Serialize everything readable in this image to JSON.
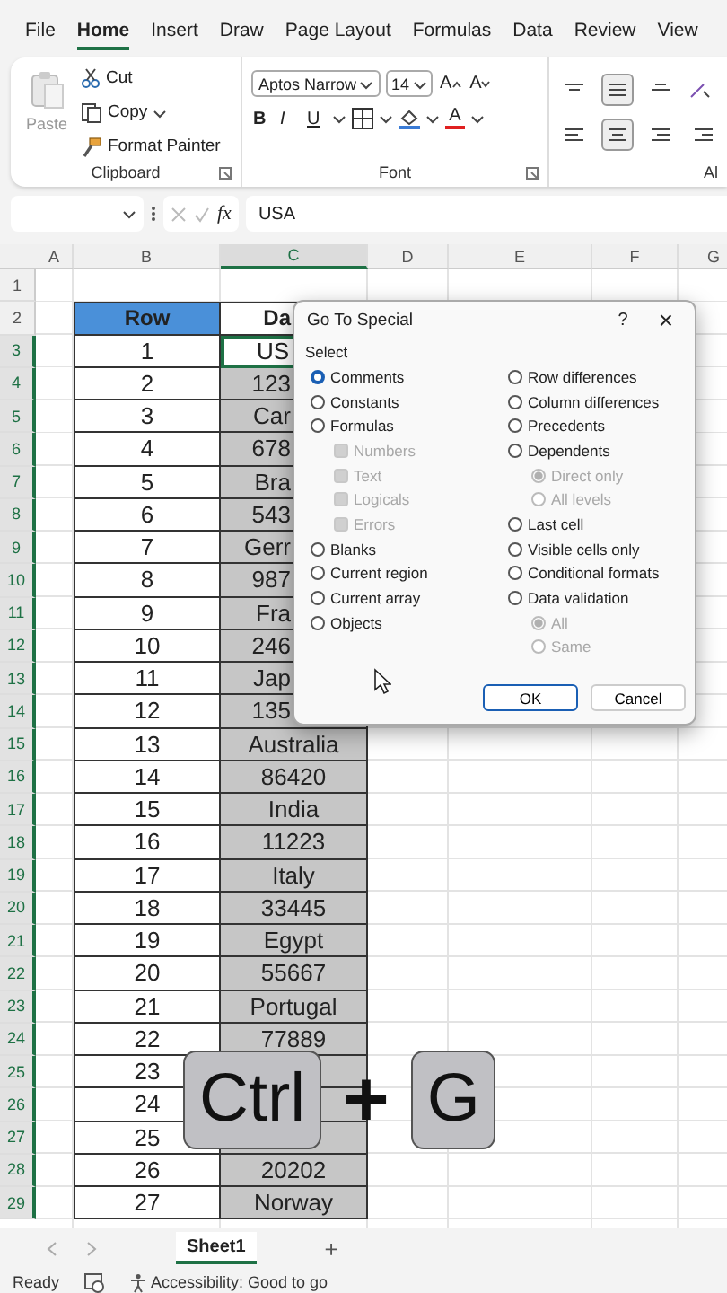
{
  "ribbon_tabs": [
    {
      "label": "File",
      "selected": false
    },
    {
      "label": "Home",
      "selected": true
    },
    {
      "label": "Insert",
      "selected": false
    },
    {
      "label": "Draw",
      "selected": false
    },
    {
      "label": "Page Layout",
      "selected": false
    },
    {
      "label": "Formulas",
      "selected": false
    },
    {
      "label": "Data",
      "selected": false
    },
    {
      "label": "Review",
      "selected": false
    },
    {
      "label": "View",
      "selected": false
    }
  ],
  "clipboard": {
    "paste": "Paste",
    "cut": "Cut",
    "copy": "Copy",
    "format_painter": "Format Painter",
    "label": "Clipboard"
  },
  "font": {
    "name": "Aptos Narrow",
    "size": "14",
    "grow": "A",
    "shrink": "A",
    "bold": "B",
    "italic": "I",
    "underline": "U",
    "font_color": "A",
    "label": "Font"
  },
  "alignment": {
    "label": "Al"
  },
  "formula_bar": {
    "fx": "fx",
    "value": "USA"
  },
  "columns": [
    {
      "label": "A",
      "selected": false
    },
    {
      "label": "B",
      "selected": false
    },
    {
      "label": "C",
      "selected": true
    },
    {
      "label": "D",
      "selected": false
    },
    {
      "label": "E",
      "selected": false
    },
    {
      "label": "F",
      "selected": false
    },
    {
      "label": "G",
      "selected": false
    }
  ],
  "rows": [
    {
      "n": "1",
      "kind": "blank"
    },
    {
      "n": "2",
      "kind": "header",
      "b": "Row",
      "c": "Da",
      "c_cut": true
    },
    {
      "n": "3",
      "kind": "data",
      "b": "1",
      "c": "US",
      "c_cut": true,
      "selected": false
    },
    {
      "n": "4",
      "kind": "data",
      "b": "2",
      "c": "123",
      "c_cut": true,
      "selected": true
    },
    {
      "n": "5",
      "kind": "data",
      "b": "3",
      "c": "Car",
      "c_cut": true,
      "selected": true
    },
    {
      "n": "6",
      "kind": "data",
      "b": "4",
      "c": "678",
      "c_cut": true,
      "selected": true
    },
    {
      "n": "7",
      "kind": "data",
      "b": "5",
      "c": "Bra",
      "c_cut": true,
      "selected": true
    },
    {
      "n": "8",
      "kind": "data",
      "b": "6",
      "c": "543",
      "c_cut": true,
      "selected": true
    },
    {
      "n": "9",
      "kind": "data",
      "b": "7",
      "c": "Gerr",
      "c_cut": true,
      "selected": true
    },
    {
      "n": "10",
      "kind": "data",
      "b": "8",
      "c": "987",
      "c_cut": true,
      "selected": true
    },
    {
      "n": "11",
      "kind": "data",
      "b": "9",
      "c": "Fra",
      "c_cut": true,
      "selected": true
    },
    {
      "n": "12",
      "kind": "data",
      "b": "10",
      "c": "246",
      "c_cut": true,
      "selected": true
    },
    {
      "n": "13",
      "kind": "data",
      "b": "11",
      "c": "Jap",
      "c_cut": true,
      "selected": true
    },
    {
      "n": "14",
      "kind": "data",
      "b": "12",
      "c": "135",
      "c_cut": true,
      "selected": true
    },
    {
      "n": "15",
      "kind": "data",
      "b": "13",
      "c": "Australia",
      "selected": true
    },
    {
      "n": "16",
      "kind": "data",
      "b": "14",
      "c": "86420",
      "selected": true
    },
    {
      "n": "17",
      "kind": "data",
      "b": "15",
      "c": "India",
      "selected": true
    },
    {
      "n": "18",
      "kind": "data",
      "b": "16",
      "c": "11223",
      "selected": true
    },
    {
      "n": "19",
      "kind": "data",
      "b": "17",
      "c": "Italy",
      "selected": true
    },
    {
      "n": "20",
      "kind": "data",
      "b": "18",
      "c": "33445",
      "selected": true
    },
    {
      "n": "21",
      "kind": "data",
      "b": "19",
      "c": "Egypt",
      "selected": true
    },
    {
      "n": "22",
      "kind": "data",
      "b": "20",
      "c": "55667",
      "selected": true
    },
    {
      "n": "23",
      "kind": "data",
      "b": "21",
      "c": "Portugal",
      "selected": true
    },
    {
      "n": "24",
      "kind": "data",
      "b": "22",
      "c": "77889",
      "selected": true
    },
    {
      "n": "25",
      "kind": "data",
      "b": "23",
      "selected": true
    },
    {
      "n": "26",
      "kind": "data",
      "b": "24",
      "selected": true
    },
    {
      "n": "27",
      "kind": "data",
      "b": "25",
      "selected": true
    },
    {
      "n": "28",
      "kind": "data",
      "b": "26",
      "c": "20202",
      "selected": true
    },
    {
      "n": "29",
      "kind": "data",
      "b": "27",
      "c": "Norway",
      "selected": true
    }
  ],
  "dialog": {
    "title": "Go To Special",
    "help": "?",
    "close": "×",
    "group_label": "Select",
    "left": [
      {
        "kind": "radio",
        "label": "Comments",
        "selected": true,
        "disabled": false
      },
      {
        "kind": "radio",
        "label": "Constants",
        "selected": false,
        "disabled": false
      },
      {
        "kind": "radio",
        "label": "Formulas",
        "selected": false,
        "disabled": false
      },
      {
        "kind": "checkbox",
        "label": "Numbers",
        "checked": true,
        "disabled": true
      },
      {
        "kind": "checkbox",
        "label": "Text",
        "checked": true,
        "disabled": true
      },
      {
        "kind": "checkbox",
        "label": "Logicals",
        "checked": true,
        "disabled": true
      },
      {
        "kind": "checkbox",
        "label": "Errors",
        "checked": true,
        "disabled": true
      },
      {
        "kind": "radio",
        "label": "Blanks",
        "selected": false,
        "disabled": false
      },
      {
        "kind": "radio",
        "label": "Current region",
        "selected": false,
        "disabled": false
      },
      {
        "kind": "radio",
        "label": "Current array",
        "selected": false,
        "disabled": false
      },
      {
        "kind": "radio",
        "label": "Objects",
        "selected": false,
        "disabled": false
      }
    ],
    "right": [
      {
        "kind": "radio",
        "label": "Row differences",
        "selected": false,
        "disabled": false
      },
      {
        "kind": "radio",
        "label": "Column differences",
        "selected": false,
        "disabled": false
      },
      {
        "kind": "radio",
        "label": "Precedents",
        "selected": false,
        "disabled": false
      },
      {
        "kind": "radio",
        "label": "Dependents",
        "selected": false,
        "disabled": false
      },
      {
        "kind": "subradio",
        "label": "Direct only",
        "selected": true,
        "disabled": true
      },
      {
        "kind": "subradio",
        "label": "All levels",
        "selected": false,
        "disabled": true
      },
      {
        "kind": "radio",
        "label": "Last cell",
        "selected": false,
        "disabled": false
      },
      {
        "kind": "radio",
        "label": "Visible cells only",
        "selected": false,
        "disabled": false
      },
      {
        "kind": "radio",
        "label": "Conditional formats",
        "selected": false,
        "disabled": false
      },
      {
        "kind": "radio",
        "label": "Data validation",
        "selected": false,
        "disabled": false
      },
      {
        "kind": "subradio",
        "label": "All",
        "selected": true,
        "disabled": true
      },
      {
        "kind": "subradio",
        "label": "Same",
        "selected": false,
        "disabled": true
      }
    ],
    "buttons": [
      {
        "label": "OK",
        "default": true
      },
      {
        "label": "Cancel",
        "default": false
      }
    ]
  },
  "keys": [
    {
      "kind": "key",
      "label": "Ctrl"
    },
    {
      "kind": "plus",
      "label": "+"
    },
    {
      "kind": "key",
      "label": "G"
    }
  ],
  "sheet_tabs": [
    {
      "label": "Sheet1",
      "selected": true
    }
  ],
  "add_sheet": "+",
  "status": {
    "mode": "Ready",
    "accessibility": "Accessibility: Good to go"
  }
}
